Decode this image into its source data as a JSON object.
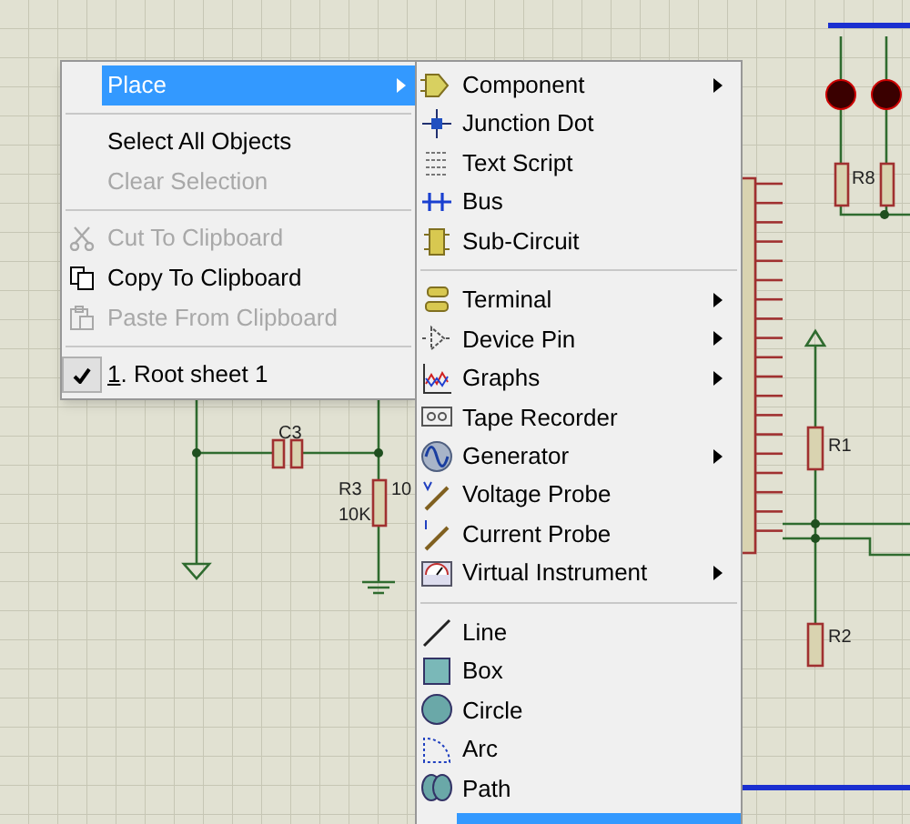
{
  "schematic": {
    "labels": [
      {
        "text": "C3"
      },
      {
        "text": "R3"
      },
      {
        "text": "10K"
      },
      {
        "text": "10"
      },
      {
        "text": "R8"
      },
      {
        "text": "R1"
      },
      {
        "text": "R2"
      }
    ]
  },
  "context_menu": {
    "items": [
      {
        "kind": "item",
        "label": "Place",
        "selected": true,
        "disabled": false,
        "submenu": true
      },
      {
        "kind": "separator"
      },
      {
        "kind": "item",
        "label": "Select All Objects",
        "selected": false,
        "disabled": false,
        "submenu": false
      },
      {
        "kind": "item",
        "label": "Clear Selection",
        "selected": false,
        "disabled": true,
        "submenu": false
      },
      {
        "kind": "separator"
      },
      {
        "kind": "item",
        "label": "Cut To Clipboard",
        "selected": false,
        "disabled": true,
        "submenu": false
      },
      {
        "kind": "item",
        "label": "Copy To Clipboard",
        "selected": false,
        "disabled": false,
        "submenu": false
      },
      {
        "kind": "item",
        "label": "Paste From Clipboard",
        "selected": false,
        "disabled": true,
        "submenu": false
      },
      {
        "kind": "separator"
      },
      {
        "kind": "item",
        "label": "1. Root sheet 1",
        "selected": false,
        "disabled": false,
        "submenu": false,
        "checked": true
      }
    ]
  },
  "place_submenu": {
    "items": [
      {
        "kind": "item",
        "label": "Component",
        "submenu": true
      },
      {
        "kind": "item",
        "label": "Junction Dot",
        "submenu": false
      },
      {
        "kind": "item",
        "label": "Text Script",
        "submenu": false
      },
      {
        "kind": "item",
        "label": "Bus",
        "submenu": false
      },
      {
        "kind": "item",
        "label": "Sub-Circuit",
        "submenu": false
      },
      {
        "kind": "separator"
      },
      {
        "kind": "item",
        "label": "Terminal",
        "submenu": true
      },
      {
        "kind": "item",
        "label": "Device Pin",
        "submenu": true
      },
      {
        "kind": "item",
        "label": "Graphs",
        "submenu": true
      },
      {
        "kind": "item",
        "label": "Tape Recorder",
        "submenu": false
      },
      {
        "kind": "item",
        "label": "Generator",
        "submenu": true
      },
      {
        "kind": "item",
        "label": "Voltage Probe",
        "submenu": false
      },
      {
        "kind": "item",
        "label": "Current Probe",
        "submenu": false
      },
      {
        "kind": "item",
        "label": "Virtual Instrument",
        "submenu": true
      },
      {
        "kind": "separator"
      },
      {
        "kind": "item",
        "label": "Line",
        "submenu": false
      },
      {
        "kind": "item",
        "label": "Box",
        "submenu": false
      },
      {
        "kind": "item",
        "label": "Circle",
        "submenu": false
      },
      {
        "kind": "item",
        "label": "Arc",
        "submenu": false
      },
      {
        "kind": "item",
        "label": "Path",
        "submenu": false
      },
      {
        "kind": "highlight"
      }
    ]
  }
}
